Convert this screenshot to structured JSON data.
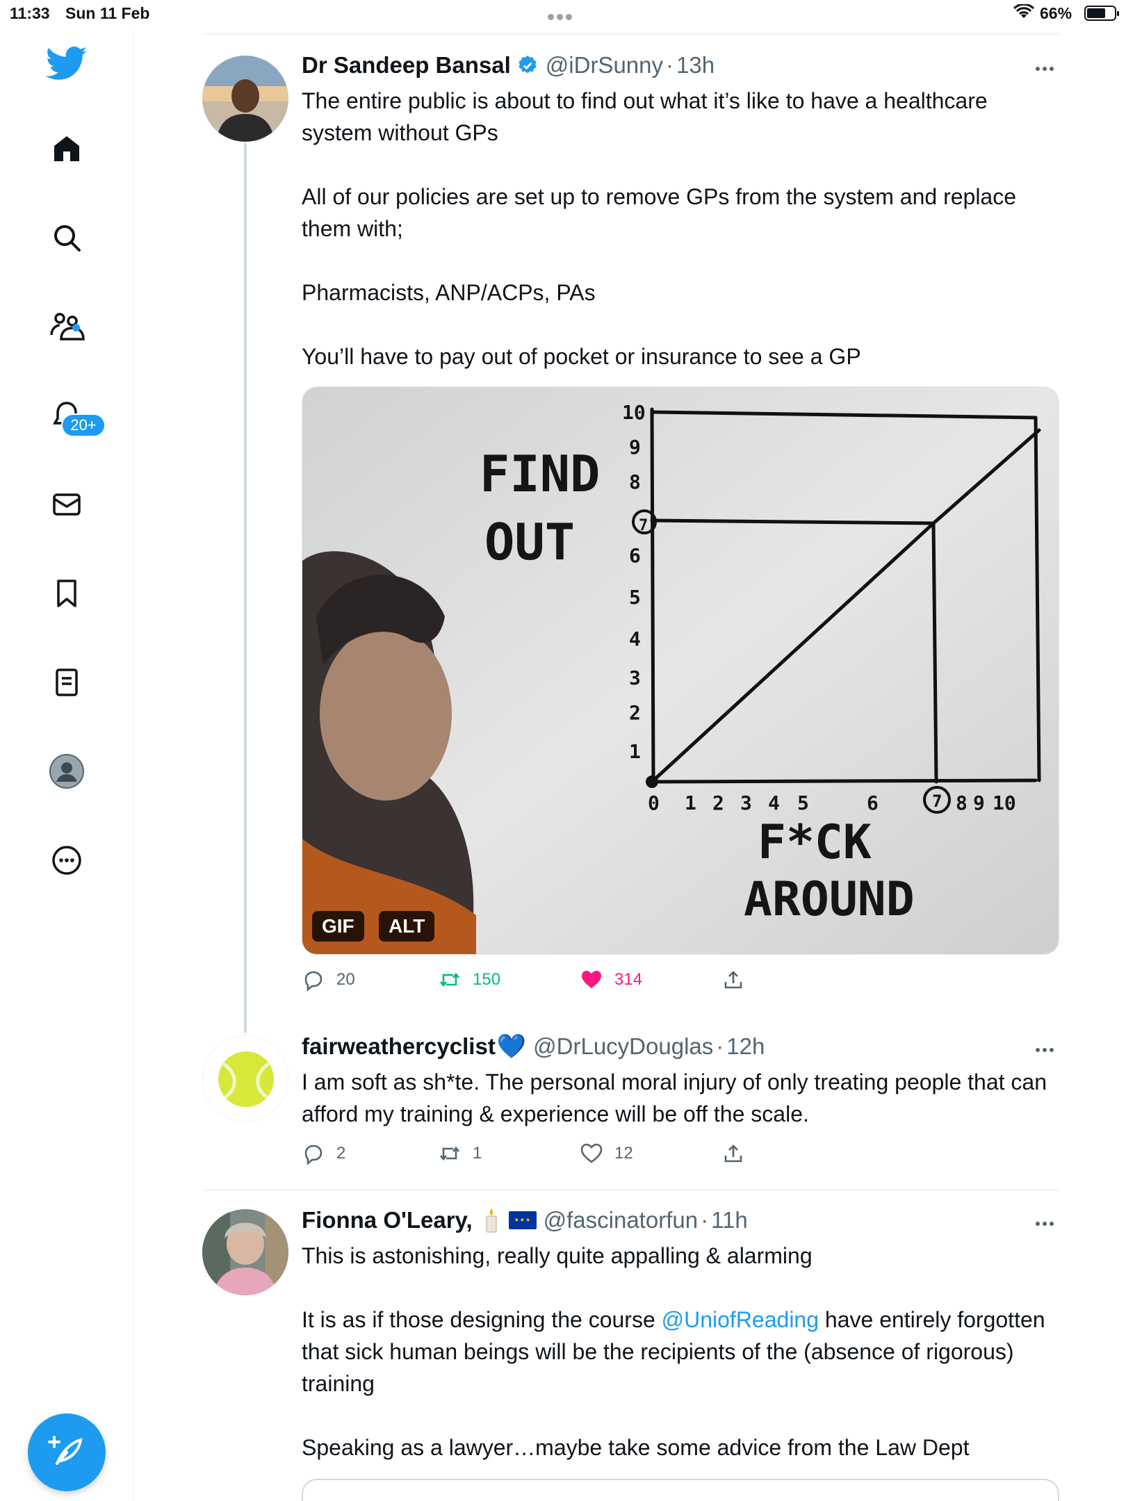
{
  "status_bar": {
    "time": "11:33",
    "date": "Sun 11 Feb",
    "battery": "66%"
  },
  "sidebar": {
    "items": [
      {
        "icon": "twitter-logo-icon"
      },
      {
        "icon": "home-icon"
      },
      {
        "icon": "search-icon"
      },
      {
        "icon": "communities-icon"
      },
      {
        "icon": "notifications-icon",
        "badge": "20+"
      },
      {
        "icon": "messages-icon"
      },
      {
        "icon": "bookmarks-icon"
      },
      {
        "icon": "lists-icon"
      },
      {
        "icon": "profile-icon"
      },
      {
        "icon": "more-icon"
      }
    ],
    "compose_icon": "compose-icon"
  },
  "colors": {
    "accent": "#1d9bf0",
    "like_active": "#f91880",
    "retweet_active": "#00ba7c",
    "secondary_text": "#536471"
  },
  "tweets": [
    {
      "name": "Dr Sandeep Bansal",
      "verified": true,
      "handle": "@iDrSunny",
      "time": "13h",
      "text": [
        "The entire public is about to find out what it’s like to have a healthcare system without GPs",
        "All of our policies are set up to remove GPs from the system and replace them with;",
        "Pharmacists, ANP/ACPs, PAs",
        "You’ll have to pay out of pocket or insurance to see a GP"
      ],
      "media": {
        "chip_gif": "GIF",
        "chip_alt": "ALT",
        "whiteboard_text": {
          "y_label_1": "FIND",
          "y_label_2": "OUT",
          "x_label_1": "F*CK",
          "x_label_2": "AROUND"
        }
      },
      "replies": "20",
      "retweets": "150",
      "likes": "314"
    },
    {
      "name": "fairweathercyclist",
      "name_emoji": "💙",
      "handle": "@DrLucyDouglas",
      "time": "12h",
      "text": [
        "I am soft as sh*te. The personal moral injury of only treating people that can afford my training & experience will be off the scale."
      ],
      "replies": "2",
      "retweets": "1",
      "likes": "12"
    },
    {
      "name": "Fionna O'Leary,",
      "handle": "@fascinatorfun",
      "time": "11h",
      "text_1": "This is astonishing, really quite appalling & alarming",
      "text_2_before": "It is as if those designing the course ",
      "text_2_link": "@UniofReading",
      "text_2_after": " have entirely forgotten that sick human beings will be the recipients of the (absence of rigorous) training",
      "text_3": "Speaking as a lawyer…maybe take some advice from the Law Dept"
    }
  ]
}
